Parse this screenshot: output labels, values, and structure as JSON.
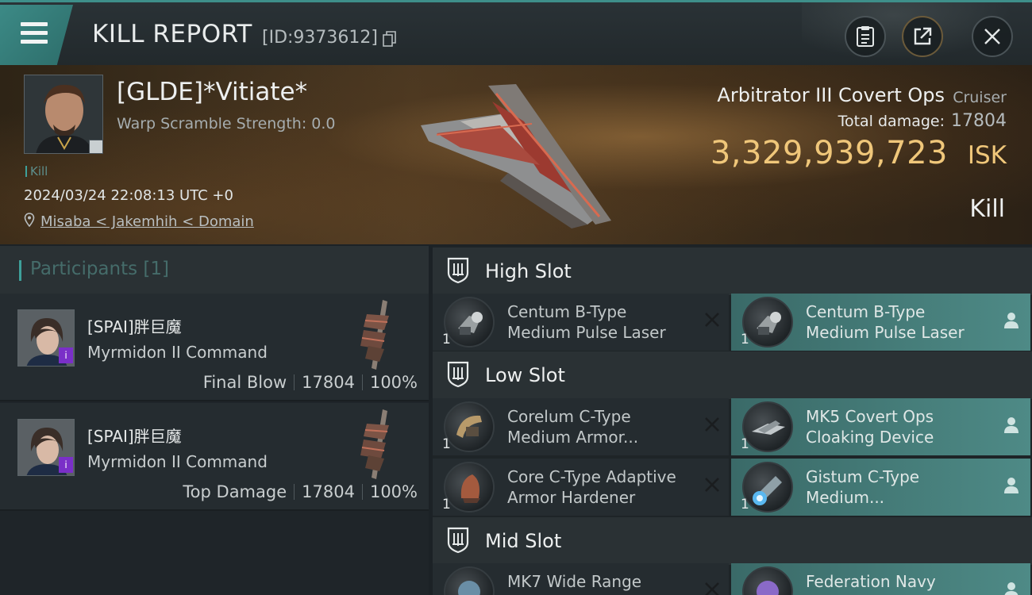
{
  "header": {
    "title": "KILL REPORT",
    "report_id": "[ID:9373612]"
  },
  "victim": {
    "name": "[GLDE]*Vitiate*",
    "warp_scramble": "Warp Scramble Strength: 0.0",
    "tag": "Kill",
    "datetime": "2024/03/24 22:08:13 UTC +0",
    "location": "Misaba < Jakemhih < Domain",
    "ship_name": "Arbitrator III Covert Ops",
    "ship_class": "Cruiser",
    "total_damage_label": "Total damage:",
    "total_damage": "17804",
    "isk_value": "3,329,939,723",
    "isk_unit": "ISK",
    "result": "Kill"
  },
  "participants": {
    "title": "Participants [1]",
    "items": [
      {
        "name": "[SPAI]胖巨魔",
        "ship": "Myrmidon II Command",
        "role": "Final Blow",
        "damage": "17804",
        "percent": "100%"
      },
      {
        "name": "[SPAI]胖巨魔",
        "ship": "Myrmidon II Command",
        "role": "Top Damage",
        "damage": "17804",
        "percent": "100%"
      }
    ]
  },
  "fitting": {
    "high_slot": {
      "title": "High Slot",
      "destroyed": {
        "line1": "Centum B-Type",
        "line2": "Medium Pulse Laser",
        "qty": "1"
      },
      "dropped": {
        "line1": "Centum B-Type",
        "line2": "Medium Pulse Laser",
        "qty": "1"
      }
    },
    "low_slot": {
      "title": "Low Slot",
      "rows": [
        {
          "destroyed": {
            "line1": "Corelum C-Type",
            "line2": "Medium Armor...",
            "qty": "1"
          },
          "dropped": {
            "line1": "MK5 Covert Ops",
            "line2": "Cloaking Device",
            "qty": "1"
          }
        },
        {
          "destroyed": {
            "line1": "Core C-Type Adaptive",
            "line2": "Armor Hardener",
            "qty": "1"
          },
          "dropped": {
            "line1": "Gistum C-Type",
            "line2": "Medium...",
            "qty": "1"
          }
        }
      ]
    },
    "mid_slot": {
      "title": "Mid Slot",
      "destroyed": {
        "line1": "MK7 Wide Range"
      },
      "dropped": {
        "line1": "Federation Navy"
      }
    }
  },
  "colors": {
    "accent_teal": "#3ea09a",
    "isk_gold": "#f0c77a",
    "dropped_bg": "#4e8a86"
  }
}
